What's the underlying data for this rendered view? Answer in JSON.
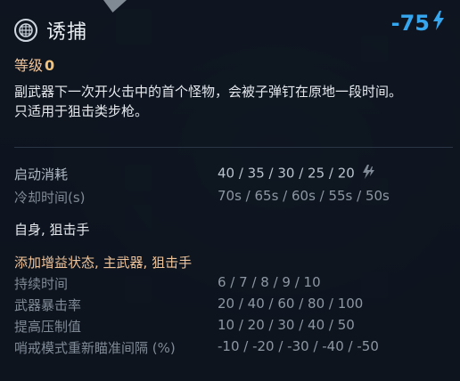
{
  "tooltip": {
    "title": "诱捕",
    "cost": "-75",
    "level_label": "等级",
    "level_value": "0",
    "description_line1": "副武器下一次开火击中的首个怪物，会被子弹钉在原地一段时间。",
    "description_line2": "只适用于狙击类步枪。"
  },
  "stats": {
    "activation_cost_label": "启动消耗",
    "activation_cost_value": "40 / 35 / 30 / 25 / 20",
    "cooldown_label": "冷却时间(s)",
    "cooldown_value": "70s / 65s / 60s / 55s / 50s"
  },
  "target": {
    "label": "自身, 狙击手"
  },
  "buff": {
    "label": "添加增益状态, 主武器, 狙击手",
    "duration_label": "持续时间",
    "duration_value": "6 / 7 / 8 / 9 / 10",
    "crit_label": "武器暴击率",
    "crit_value": "20 / 40 / 60 / 80 / 100",
    "suppression_label": "提高压制值",
    "suppression_value": "10 / 20 / 30 / 40 / 50",
    "scope_label": "哨戒模式重新瞄准间隔 (%)",
    "scope_value": "-10 / -20 / -30 / -40 / -50"
  },
  "colors": {
    "accent_blue": "#36a6ef",
    "orange": "#f0c49a"
  },
  "icons": {
    "skill_icon": "crosshair-grid-icon",
    "cost_icon": "lightning-icon"
  }
}
